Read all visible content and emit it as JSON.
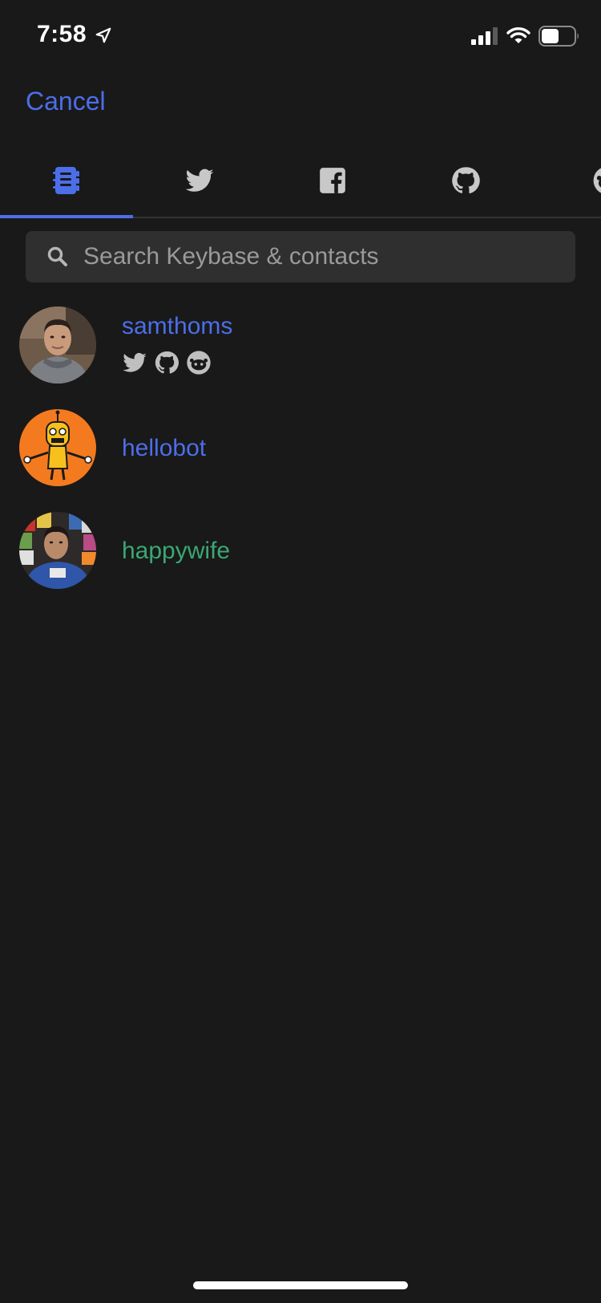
{
  "status_bar": {
    "time": "7:58",
    "icons": [
      "location-arrow-icon",
      "cellular-signal-icon",
      "wifi-icon",
      "battery-icon"
    ]
  },
  "header": {
    "cancel_label": "Cancel"
  },
  "tabs": [
    {
      "name": "keybase-contacts",
      "icon": "address-book-icon",
      "selected": true
    },
    {
      "name": "twitter",
      "icon": "twitter-icon",
      "selected": false
    },
    {
      "name": "facebook",
      "icon": "facebook-icon",
      "selected": false
    },
    {
      "name": "github",
      "icon": "github-icon",
      "selected": false
    },
    {
      "name": "reddit",
      "icon": "reddit-icon",
      "selected": false
    }
  ],
  "search": {
    "placeholder": "Search Keybase & contacts",
    "value": ""
  },
  "results": [
    {
      "username": "samthoms",
      "color": "#4c6ee9",
      "proofs": [
        "twitter-icon",
        "github-icon",
        "reddit-icon"
      ]
    },
    {
      "username": "hellobot",
      "color": "#4c6ee9",
      "proofs": []
    },
    {
      "username": "happywife",
      "color": "#3ba773",
      "proofs": []
    }
  ],
  "colors": {
    "background": "#191919",
    "accent": "#4c6ee9",
    "follow_green": "#3ba773",
    "search_bg": "#2f2f2f",
    "icon_gray": "#bfbfbf"
  }
}
